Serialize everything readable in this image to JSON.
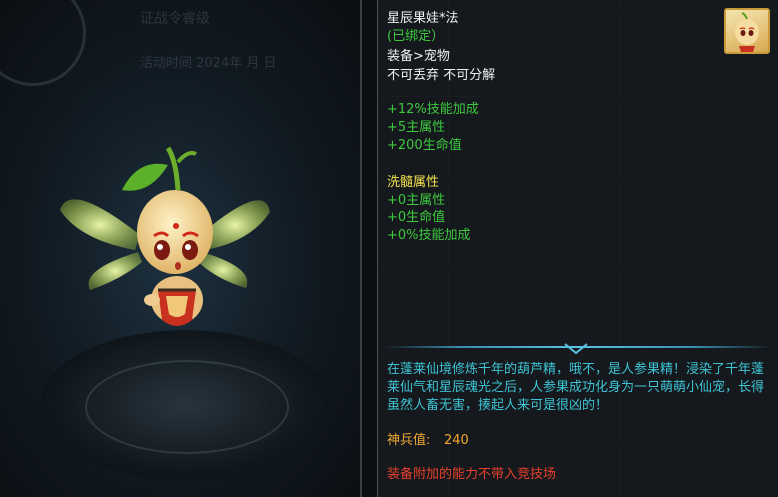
{
  "preview": {
    "bg_text_1": "证战令睿级",
    "bg_text_2": "活动时间 2024年 月 日"
  },
  "item": {
    "name": "星辰果娃*法",
    "bound_status": "(已绑定）",
    "category": "装备>宠物",
    "restrictions": "不可丢弃 不可分解",
    "icon": "chibi-pet-portrait-icon",
    "base_stats": [
      "+12%技能加成",
      "+5主属性",
      "+200生命值"
    ],
    "refine_title": "洗髓属性",
    "refine_stats": [
      "+0主属性",
      "+0生命值",
      "+0%技能加成"
    ],
    "description": "在蓬莱仙境修炼千年的葫芦精，哦不，是人参果精！浸染了千年蓬莱仙气和星辰魂光之后，人参果成功化身为一只萌萌小仙宠，长得虽然人畜无害，揍起人来可是很凶的！",
    "power_label": "神兵值:",
    "power_value": "240",
    "warning": "装备附加的能力不带入竞技场"
  },
  "colors": {
    "name": "#f0f0f0",
    "stat_green": "#3ec83e",
    "refine_yellow": "#f2e24a",
    "desc_cyan": "#3ec4d4",
    "power_orange": "#f0a830",
    "warning_red": "#e8402c"
  }
}
